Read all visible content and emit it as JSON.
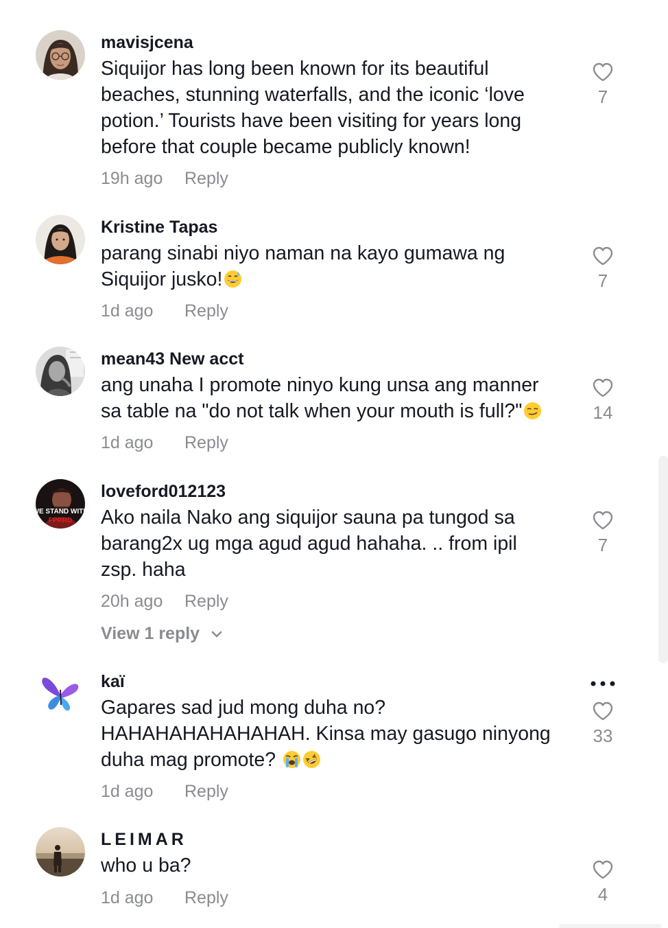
{
  "comments": [
    {
      "username": "mavisjcena",
      "lines": [
        "Siquijor has long been known for its beautiful",
        "beaches, stunning waterfalls, and the iconic ‘love",
        "potion.’ Tourists have been visiting for years long",
        "before that couple became publicly known!"
      ],
      "time": "19h ago",
      "reply_label": "Reply",
      "likes": "7",
      "avatar_icon": "avatar-woman-glasses"
    },
    {
      "username": "Kristine Tapas",
      "lines": [
        "parang sinabi niyo naman na kayo gumawa ng",
        "Siquijor jusko!"
      ],
      "emojis": [
        "grinning-sweat-emoji"
      ],
      "time": "1d ago",
      "reply_label": "Reply",
      "likes": "7",
      "avatar_icon": "avatar-woman-orange"
    },
    {
      "username": "mean43 New acct",
      "lines": [
        "ang unaha I promote ninyo kung unsa ang manner",
        "sa table na \"do not talk when your mouth is full?\""
      ],
      "emojis": [
        "smirking-emoji"
      ],
      "time": "1d ago",
      "reply_label": "Reply",
      "likes": "14",
      "avatar_icon": "avatar-woman-grayscale"
    },
    {
      "username": "loveford012123",
      "lines": [
        "Ako naila Nako ang siquijor sauna pa tungod sa",
        "barang2x ug mga agud agud hahaha. .. from ipil",
        "zsp. haha"
      ],
      "time": "20h ago",
      "reply_label": "Reply",
      "likes": "7",
      "view_replies": "View 1 reply",
      "avatar_icon": "avatar-we-stand-with-fprrd",
      "avatar_text_top": "WE STAND WITH",
      "avatar_text_bottom": "FPRRD"
    },
    {
      "username": "kaï",
      "lines": [
        "Gapares sad jud mong duha no?",
        "HAHAHAHAHAHAHAH. Kinsa may gasugo ninyong",
        "duha mag promote?"
      ],
      "emojis": [
        "loudly-crying-emoji",
        "rolling-laughing-emoji"
      ],
      "time": "1d ago",
      "reply_label": "Reply",
      "likes": "33",
      "avatar_icon": "avatar-butterfly"
    },
    {
      "username": "LEIMAR",
      "lines": [
        "who u ba?"
      ],
      "time": "1d ago",
      "reply_label": "Reply",
      "likes": "4",
      "avatar_icon": "avatar-beach-silhouette"
    }
  ],
  "colors": {
    "text": "#161823",
    "muted": "#8a8b91",
    "icon": "#8a8b91"
  }
}
